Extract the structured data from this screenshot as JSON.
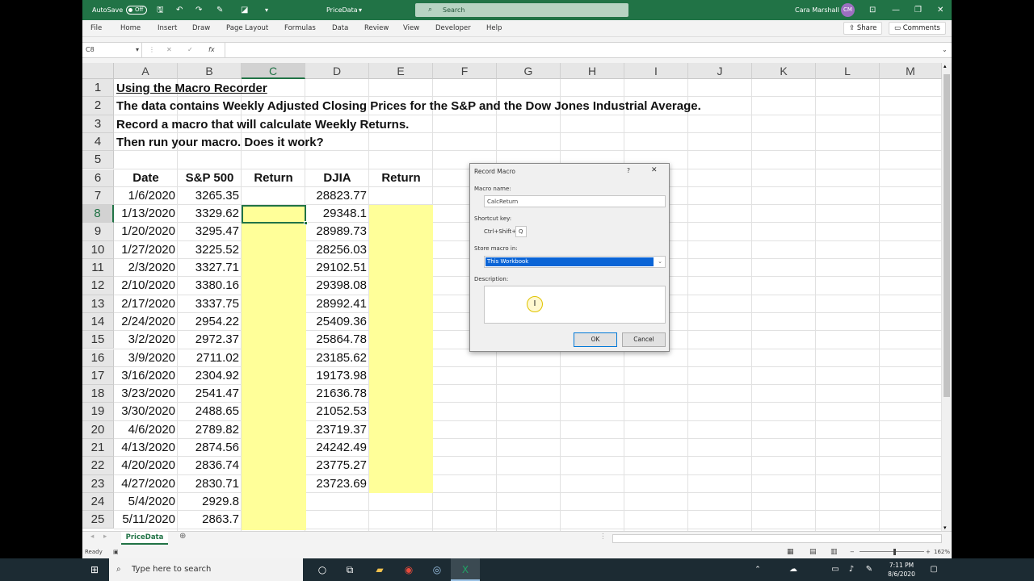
{
  "titlebar": {
    "autosave_label": "AutoSave",
    "autosave_state": "Off",
    "file_name": "PriceData",
    "search_placeholder": "Search",
    "user_name": "Cara Marshall",
    "user_initials": "CM"
  },
  "menu": {
    "tabs": [
      "File",
      "Home",
      "Insert",
      "Draw",
      "Page Layout",
      "Formulas",
      "Data",
      "Review",
      "View",
      "Developer",
      "Help"
    ],
    "share_label": "Share",
    "comments_label": "Comments"
  },
  "formula_bar": {
    "name_box": "C8",
    "fx": "fx",
    "value": ""
  },
  "columns": [
    "A",
    "B",
    "C",
    "D",
    "E",
    "F",
    "G",
    "H",
    "I",
    "J",
    "K",
    "L",
    "M"
  ],
  "rows": [
    "1",
    "2",
    "3",
    "4",
    "5",
    "6",
    "7",
    "8",
    "9",
    "10",
    "11",
    "12",
    "13",
    "14",
    "15",
    "16",
    "17",
    "18",
    "19",
    "20",
    "21",
    "22",
    "23",
    "24",
    "25"
  ],
  "sheet": {
    "title": "Using the Macro Recorder",
    "line2": "The data contains Weekly Adjusted Closing Prices for the S&P and the Dow Jones Industrial Average.",
    "line3": "Record a macro that will calculate Weekly Returns.",
    "line4": "Then run your macro.  Does it work?",
    "headers": [
      "Date",
      "S&P 500",
      "Return",
      "DJIA",
      "Return"
    ],
    "data": [
      [
        "1/6/2020",
        "3265.35",
        "28823.77"
      ],
      [
        "1/13/2020",
        "3329.62",
        "29348.1"
      ],
      [
        "1/20/2020",
        "3295.47",
        "28989.73"
      ],
      [
        "1/27/2020",
        "3225.52",
        "28256.03"
      ],
      [
        "2/3/2020",
        "3327.71",
        "29102.51"
      ],
      [
        "2/10/2020",
        "3380.16",
        "29398.08"
      ],
      [
        "2/17/2020",
        "3337.75",
        "28992.41"
      ],
      [
        "2/24/2020",
        "2954.22",
        "25409.36"
      ],
      [
        "3/2/2020",
        "2972.37",
        "25864.78"
      ],
      [
        "3/9/2020",
        "2711.02",
        "23185.62"
      ],
      [
        "3/16/2020",
        "2304.92",
        "19173.98"
      ],
      [
        "3/23/2020",
        "2541.47",
        "21636.78"
      ],
      [
        "3/30/2020",
        "2488.65",
        "21052.53"
      ],
      [
        "4/6/2020",
        "2789.82",
        "23719.37"
      ],
      [
        "4/13/2020",
        "2874.56",
        "24242.49"
      ],
      [
        "4/20/2020",
        "2836.74",
        "23775.27"
      ],
      [
        "4/27/2020",
        "2830.71",
        "23723.69"
      ],
      [
        "5/4/2020",
        "2929.8",
        ""
      ],
      [
        "5/11/2020",
        "2863.7",
        ""
      ]
    ]
  },
  "sheet_tab": "PriceData",
  "status": {
    "ready": "Ready",
    "zoom": "162%"
  },
  "dialog": {
    "title": "Record Macro",
    "help": "?",
    "close": "✕",
    "macro_name_label": "Macro name:",
    "macro_name_value": "CalcReturn",
    "shortcut_label": "Shortcut key:",
    "shortcut_prefix": "Ctrl+Shift+",
    "shortcut_value": "Q",
    "store_label": "Store macro in:",
    "store_value": "This Workbook",
    "description_label": "Description:",
    "ok_label": "OK",
    "cancel_label": "Cancel"
  },
  "taskbar": {
    "search_placeholder": "Type here to search",
    "time": "7:11 PM",
    "date": "8/6/2020"
  },
  "colors": {
    "excel_green": "#217346",
    "highlight_yellow": "#ffff99",
    "selection_blue": "#0a64d6"
  }
}
